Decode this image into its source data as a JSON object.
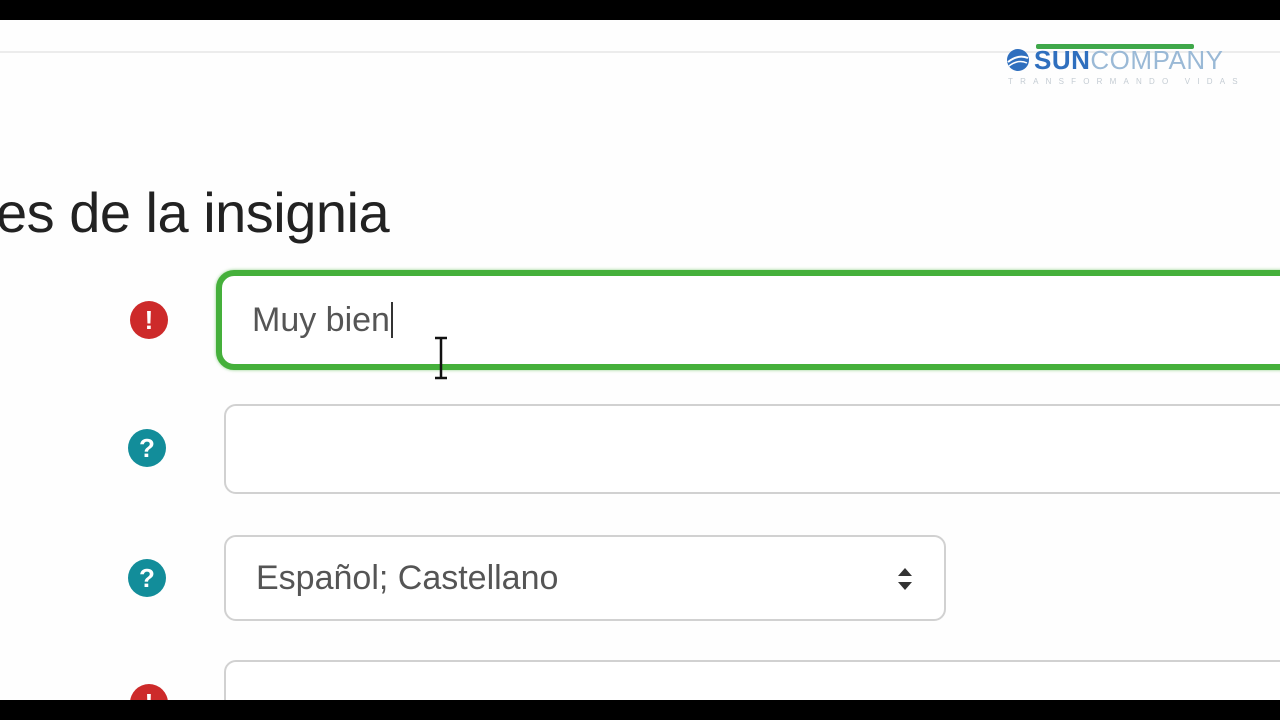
{
  "logo": {
    "brand_left": "SUN",
    "brand_right": "COMPANY",
    "tagline": "TRANSFORMANDO VIDAS",
    "colors": {
      "sun": "#2f6fbe",
      "company": "#9ab9d6",
      "bar": "#3fa84a"
    }
  },
  "section": {
    "title": "es de la insignia"
  },
  "fields": {
    "name": {
      "value": "Muy bien",
      "status_icon": "exclamation-icon",
      "status_color": "#cd2a2a"
    },
    "version": {
      "value": "",
      "status_icon": "question-icon",
      "status_color": "#128d9a"
    },
    "language": {
      "selected": "Español; Castellano",
      "status_icon": "question-icon",
      "status_color": "#128d9a"
    },
    "next": {
      "status_icon": "exclamation-icon",
      "status_color": "#cd2a2a"
    }
  },
  "icons": {
    "required": "!",
    "help": "?"
  },
  "colors": {
    "focus": "#45b03b",
    "border": "#d1d1d1",
    "text": "#555555"
  }
}
